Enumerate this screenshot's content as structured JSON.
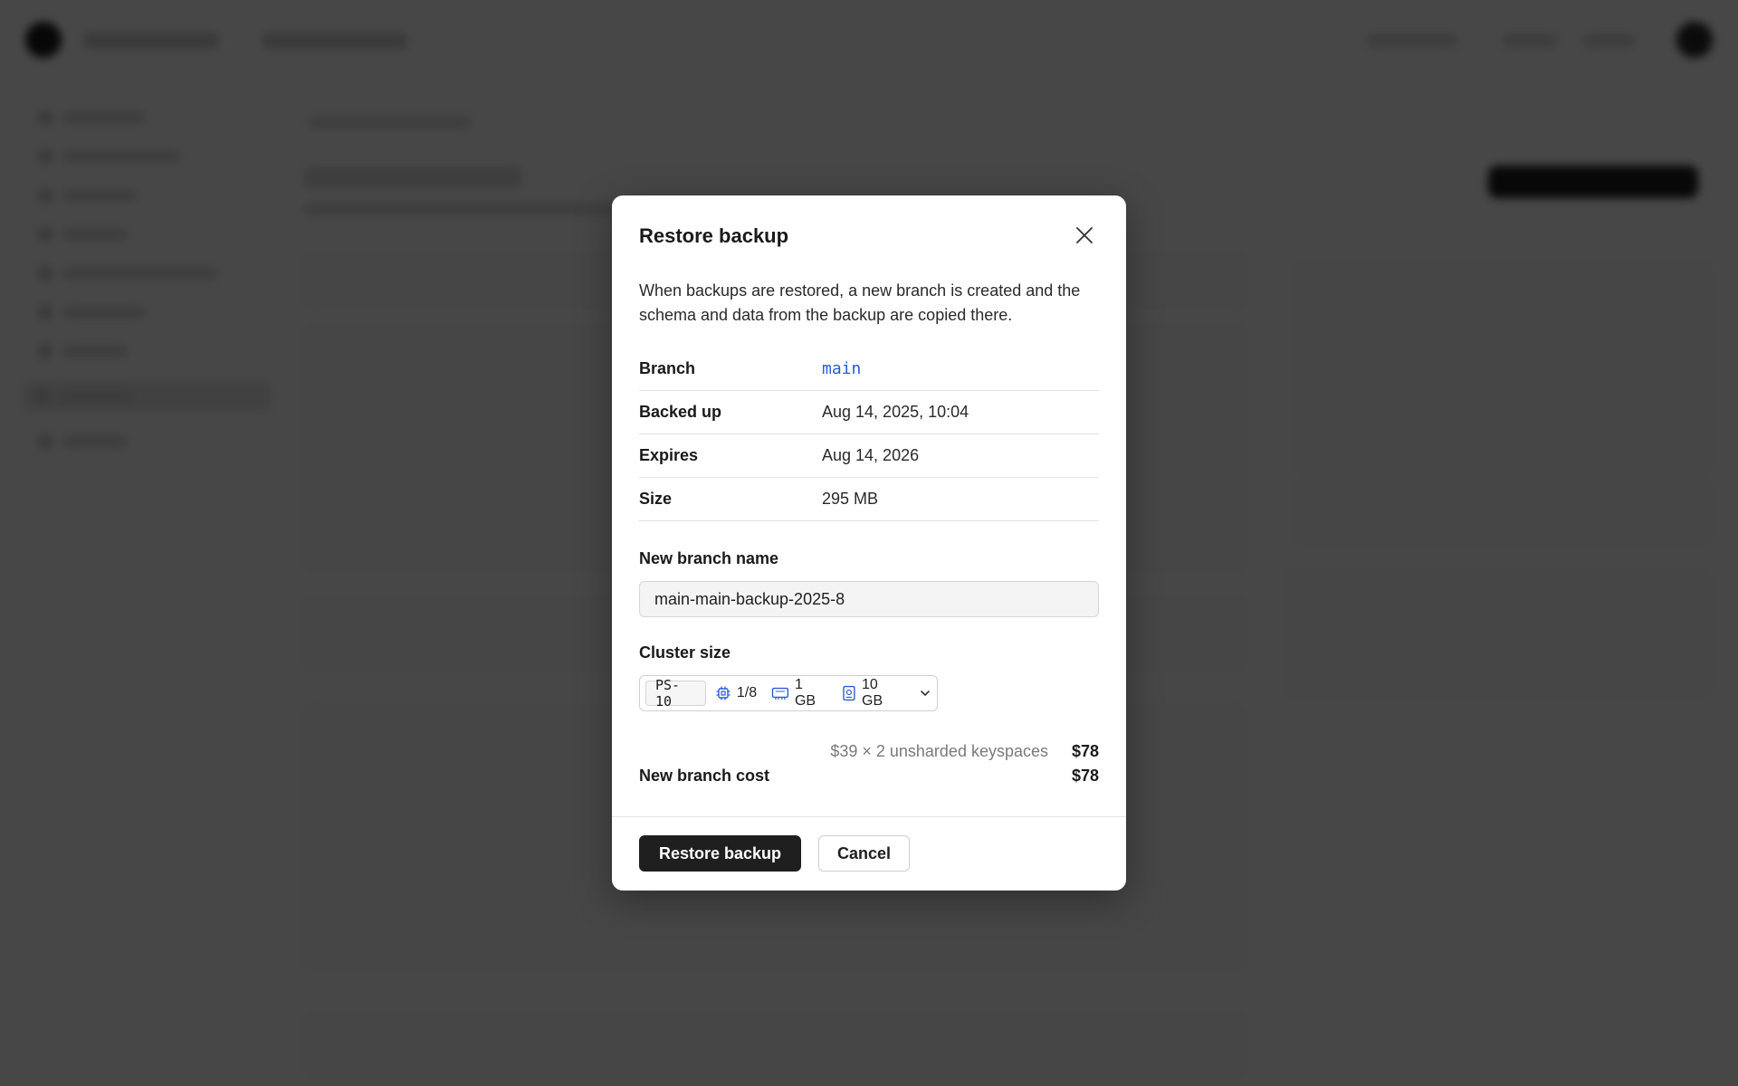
{
  "modal": {
    "title": "Restore backup",
    "description": "When backups are restored, a new branch is created and the schema and data from the backup are copied there.",
    "details": [
      {
        "label": "Branch",
        "value": "main"
      },
      {
        "label": "Backed up",
        "value": "Aug 14, 2025, 10:04"
      },
      {
        "label": "Expires",
        "value": "Aug 14, 2026"
      },
      {
        "label": "Size",
        "value": "295 MB"
      }
    ],
    "new_branch": {
      "label": "New branch name",
      "value": "main-main-backup-2025-8"
    },
    "cluster": {
      "label": "Cluster size",
      "plan": "PS-10",
      "cpu": "1/8",
      "memory": "1 GB",
      "storage": "10 GB"
    },
    "cost": {
      "breakdown": "$39 × 2 unsharded keyspaces",
      "breakdown_amount": "$78",
      "total_label": "New branch cost",
      "total_amount": "$78"
    },
    "buttons": {
      "restore": "Restore backup",
      "cancel": "Cancel"
    }
  },
  "colors": {
    "accent_link": "#2d5bd6",
    "primary_button": "#1f1f1f",
    "overlay": "rgba(0,0,0,0.72)"
  },
  "icons": {
    "close": "close-icon",
    "cpu": "cpu-icon",
    "memory": "memory-icon",
    "storage": "storage-icon",
    "dropdown": "chevron-down-icon"
  }
}
